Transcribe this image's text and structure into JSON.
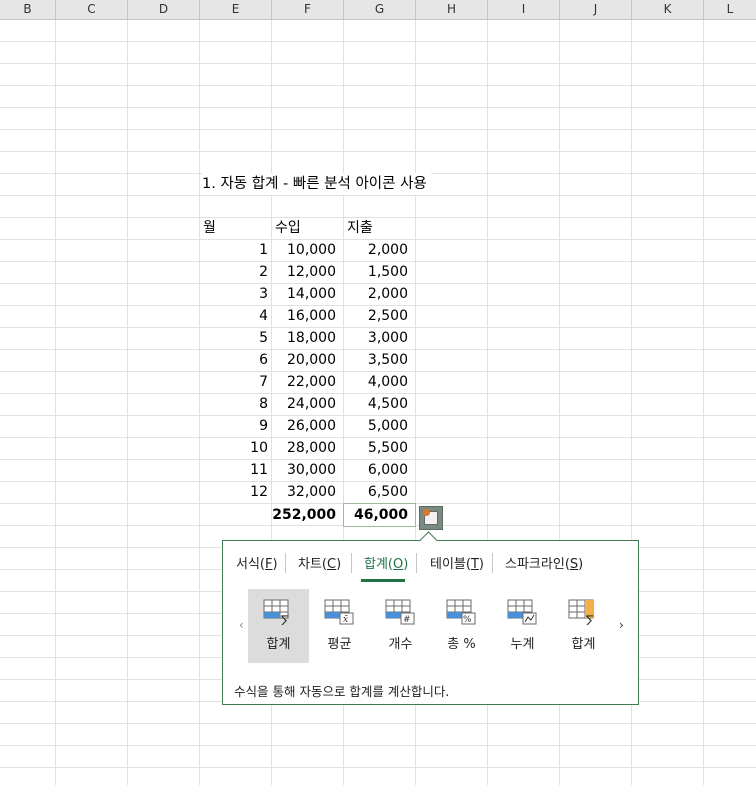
{
  "columns": [
    "B",
    "C",
    "D",
    "E",
    "F",
    "G",
    "H",
    "I",
    "J",
    "K",
    "L"
  ],
  "title": "1. 자동 합계 - 빠른 분석 아이콘 사용",
  "table": {
    "headers": [
      "월",
      "수입",
      "지출"
    ],
    "rows": [
      [
        "1",
        "10,000",
        "2,000"
      ],
      [
        "2",
        "12,000",
        "1,500"
      ],
      [
        "3",
        "14,000",
        "2,000"
      ],
      [
        "4",
        "16,000",
        "2,500"
      ],
      [
        "5",
        "18,000",
        "3,000"
      ],
      [
        "6",
        "20,000",
        "3,500"
      ],
      [
        "7",
        "22,000",
        "4,000"
      ],
      [
        "8",
        "24,000",
        "4,500"
      ],
      [
        "9",
        "26,000",
        "5,000"
      ],
      [
        "10",
        "28,000",
        "5,500"
      ],
      [
        "11",
        "30,000",
        "6,000"
      ],
      [
        "12",
        "32,000",
        "6,500"
      ]
    ],
    "totals": {
      "income": "252,000",
      "expense": "46,000"
    }
  },
  "quick_analysis": {
    "icon": "quick-analysis-icon",
    "tabs": [
      {
        "label": "서식",
        "key": "F"
      },
      {
        "label": "차트",
        "key": "C"
      },
      {
        "label": "합계",
        "key": "O"
      },
      {
        "label": "테이블",
        "key": "T"
      },
      {
        "label": "스파크라인",
        "key": "S"
      }
    ],
    "active_tab": "합계",
    "items": [
      {
        "label": "합계",
        "icon": "sum-rows-icon"
      },
      {
        "label": "평균",
        "icon": "average-icon"
      },
      {
        "label": "개수",
        "icon": "count-icon"
      },
      {
        "label": "총 %",
        "icon": "percent-total-icon"
      },
      {
        "label": "누계",
        "icon": "running-total-icon"
      },
      {
        "label": "합계",
        "icon": "sum-columns-icon"
      }
    ],
    "prev_arrow": "‹",
    "next_arrow": "›",
    "description": "수식을 통해 자동으로 합계를 계산합니다."
  },
  "colors": {
    "accent": "#217346",
    "selected_tile": "#dcdcdc",
    "blue": "#4a90d9",
    "orange": "#f3b04a"
  }
}
